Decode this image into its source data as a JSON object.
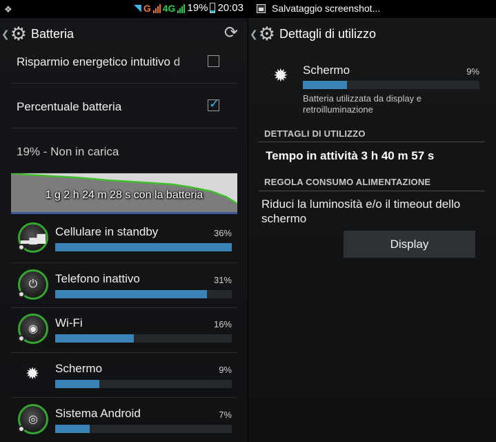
{
  "left_screen": {
    "status_bar": {
      "battery_percent": "19%",
      "time": "20:03",
      "network_g": "G",
      "network_4g": "4G"
    },
    "action_bar": {
      "title": "Batteria"
    },
    "settings": {
      "power_saving_label": "Risparmio energetico intuitivo d",
      "power_saving_checked": false,
      "battery_percentage_label": "Percentuale batteria",
      "battery_percentage_checked": true
    },
    "status_text": "19% - Non in carica",
    "graph_label": "1 g 2 h 24 m 28 s con la batteria",
    "usage": [
      {
        "label": "Cellulare in standby",
        "percent_text": "36%",
        "percent": 36,
        "icon": "signal-bars-icon"
      },
      {
        "label": "Telefono inattivo",
        "percent_text": "31%",
        "percent": 31,
        "icon": "power-icon"
      },
      {
        "label": "Wi-Fi",
        "percent_text": "16%",
        "percent": 16,
        "icon": "wifi-icon"
      },
      {
        "label": "Schermo",
        "percent_text": "9%",
        "percent": 9,
        "icon": "brightness-icon"
      },
      {
        "label": "Sistema Android",
        "percent_text": "7%",
        "percent": 7,
        "icon": "android-system-icon"
      }
    ]
  },
  "right_screen": {
    "notification_text": "Salvataggio screenshot...",
    "action_bar": {
      "title": "Dettagli di utilizzo"
    },
    "detail": {
      "title": "Schermo",
      "percent_text": "9%",
      "percent": 9,
      "description": "Batteria utilizzata da display e retroilluminazione"
    },
    "usage_section_title": "DETTAGLI DI UTILIZZO",
    "active_time": "Tempo in attività 3 h 40 m 57 s",
    "power_section_title": "REGOLA CONSUMO ALIMENTAZIONE",
    "advice": "Riduci la luminosità e/o il timeout dello schermo",
    "display_button": "Display"
  },
  "colors": {
    "accent_blue": "#3a83b6",
    "icon_ring_green": "#37a52f",
    "checkbox_tick": "#3fb6e8"
  }
}
